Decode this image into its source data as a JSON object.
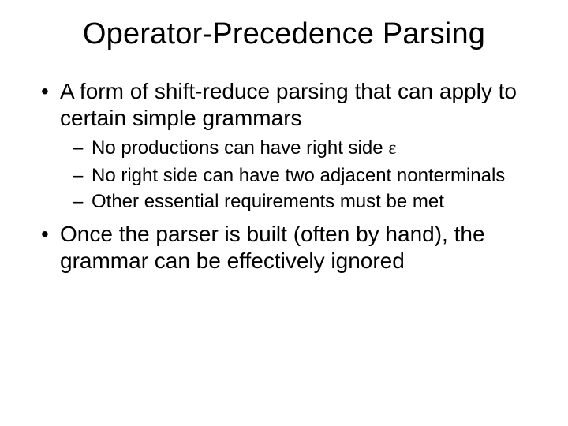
{
  "title": "Operator-Precedence Parsing",
  "bullets": {
    "b1": "A form of shift-reduce parsing that can apply to certain simple grammars",
    "sub": {
      "s1a": "No productions can have right side ",
      "s1eps": "ε",
      "s2": "No right side can have two adjacent nonterminals",
      "s3": "Other essential requirements must be met"
    },
    "b2": "Once the parser is built (often by hand), the grammar can be effectively ignored"
  }
}
